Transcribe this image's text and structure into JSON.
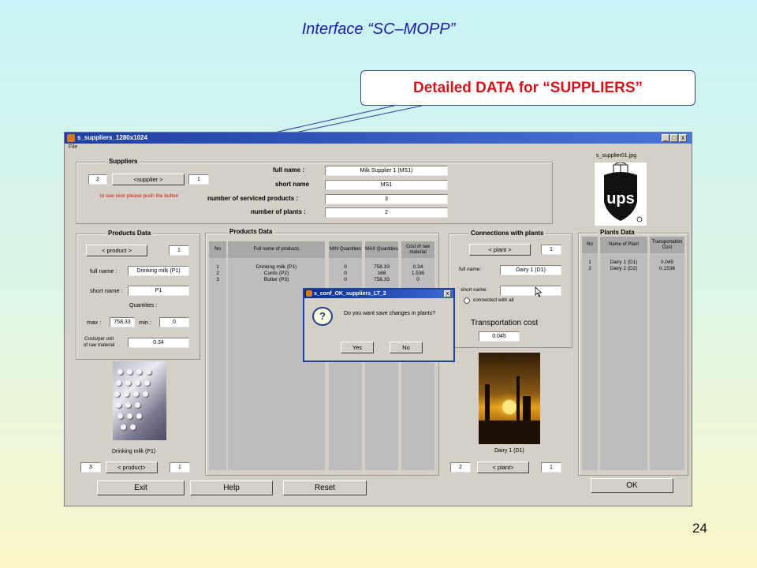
{
  "slide": {
    "title": "Interface “SC–MOPP”",
    "callout": "Detailed DATA for “SUPPLIERS”",
    "page_number": "24"
  },
  "window": {
    "title": "s_suppliers_1280x1024",
    "menu": [
      "File"
    ],
    "controls": [
      "_",
      "□",
      "x"
    ]
  },
  "suppliers": {
    "title": "Suppliers",
    "index": "2",
    "nav_label": "<supplier >",
    "total": "1",
    "hint": "to see next please push the button",
    "labels": {
      "full_name": "full name :",
      "short_name": "short name",
      "num_products": "number of serviced products :",
      "num_plants": "number of plants :"
    },
    "values": {
      "full_name": "Milk Supplier 1 (MS1)",
      "short_name": "MS1",
      "num_products": "3",
      "num_plants": "2"
    },
    "image_file": "s_supplier01.jpg"
  },
  "products_panel": {
    "title": "Products Data",
    "nav_label": "< product >",
    "index": "1",
    "full_name_label": "full name :",
    "full_name": "Drinking milk (P1)",
    "short_name_label": "short name :",
    "short_name": "P1",
    "quantities_label": "Quantities :",
    "max_label": "max :",
    "max": "758.33",
    "min_label": "min :",
    "min": "0",
    "cost_label": [
      "Costs/per unit",
      "of raw material"
    ],
    "cost": "0.34",
    "caption": "Drinking milk (P1)",
    "bottom_index": "3",
    "bottom_nav": "< product>",
    "bottom_total": "1"
  },
  "products_table": {
    "title": "Products Data",
    "headers": [
      "No",
      "Full name of products",
      "MIN Quantities",
      "MAX Quantities",
      "Cost of raw material"
    ],
    "rows": [
      [
        "1",
        "Drinking milk (P1)",
        "0",
        "758.33",
        "0.34"
      ],
      [
        "2",
        "Curds (P2)",
        "0",
        "168",
        "1.536"
      ],
      [
        "3",
        "Butter (P3)",
        "0",
        "758.33",
        "0"
      ]
    ]
  },
  "connections": {
    "title": "Connections with plants",
    "nav_label": "< plant >",
    "index": "1",
    "full_name_label": "full name:",
    "full_name": "Dairy 1 (D1)",
    "short_name_label": "short name:",
    "short_name": "",
    "radio_label": "connected with all",
    "transport_label": "Transportation cost",
    "transport_value": "0.045",
    "caption": "Dairy 1 (D1)",
    "bottom_index": "2",
    "bottom_nav": "< plant>",
    "bottom_total": "1"
  },
  "plants_table": {
    "title": "Plants Data",
    "headers": [
      "No",
      "Name of Plant",
      "Transportation Cost"
    ],
    "rows": [
      [
        "1",
        "Dairy 1 (D1)",
        "0.045"
      ],
      [
        "2",
        "Dairy  2 (D2)",
        "0.1536"
      ]
    ]
  },
  "buttons": {
    "exit": "Exit",
    "help": "Help",
    "reset": "Reset",
    "ok": "OK"
  },
  "dialog": {
    "title": "s_conf_OK_suppliers_LT_2",
    "message": "Do you want save changes in plants?",
    "yes": "Yes",
    "no": "No",
    "close": "x"
  },
  "colors": {
    "title_text": "#1a1aa6",
    "callout_text": "#d7141b",
    "titlebar": "#1f3ea0",
    "window_bg": "#d4d0c8",
    "hint_text": "#d01010"
  },
  "icons": {
    "dialog": "question-icon",
    "window": "matlab-icon",
    "logo": "ups-logo"
  }
}
